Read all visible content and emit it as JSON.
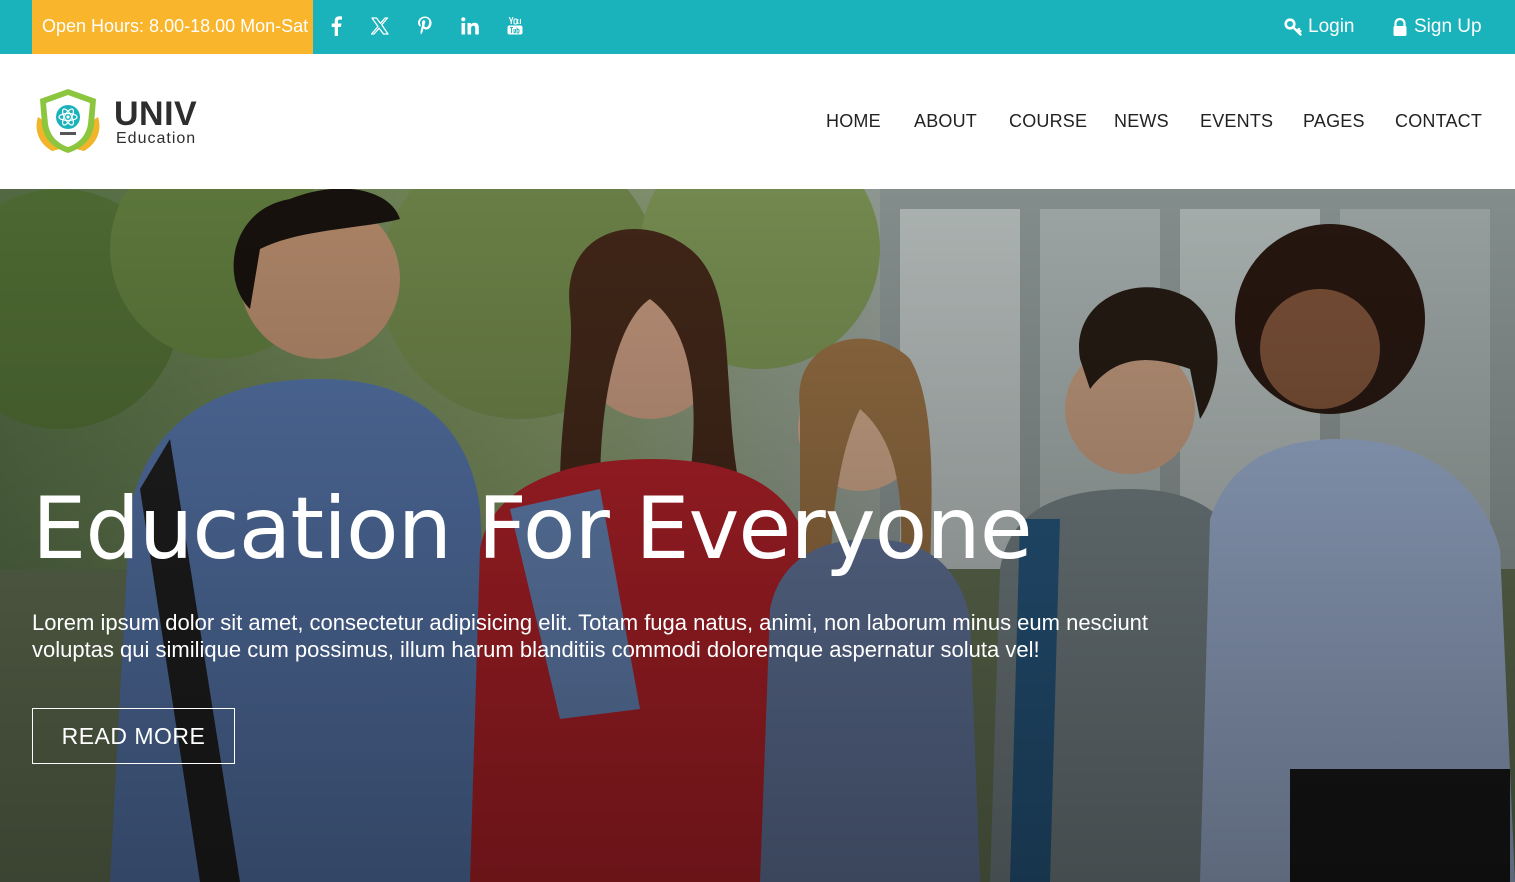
{
  "topbar": {
    "hours": "Open Hours: 8.00-18.00 Mon-Sat",
    "social_icons": [
      "facebook-icon",
      "x-twitter-icon",
      "pinterest-icon",
      "linkedin-icon",
      "youtube-icon"
    ],
    "login_label": "Login",
    "signup_label": "Sign Up"
  },
  "brand": {
    "name": "UNIV",
    "tagline": "Education"
  },
  "nav": {
    "items": [
      "HOME",
      "ABOUT",
      "COURSE",
      "NEWS",
      "EVENTS",
      "PAGES",
      "CONTACT"
    ]
  },
  "hero": {
    "title": "Education For Everyone",
    "text": "Lorem ipsum dolor sit amet, consectetur adipisicing elit. Totam fuga natus, animi, non laborum minus eum nesciunt voluptas qui similique cum possimus, illum harum blanditiis commodi doloremque aspernatur soluta vel!",
    "button_label": "READ MORE"
  },
  "colors": {
    "topbar": "#1ab2bb",
    "hours_bg": "#f9b52c",
    "text_dark": "#222222",
    "white": "#ffffff"
  }
}
